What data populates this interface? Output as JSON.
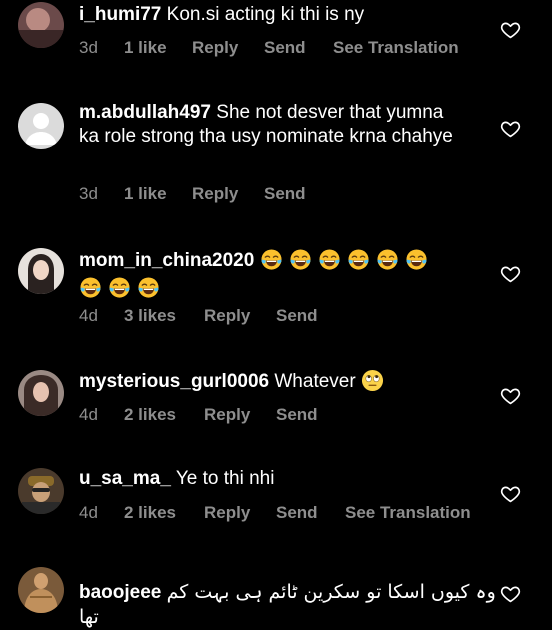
{
  "comments": [
    {
      "username": "i_humi77",
      "text": "Kon.si acting ki thi is ny",
      "time": "3d",
      "likes": "1 like",
      "reply": "Reply",
      "send": "Send",
      "translate": "See Translation"
    },
    {
      "username": "m.abdullah497",
      "text": "She not desver that yumna ka role strong tha usy nominate krna chahye",
      "time": "3d",
      "likes": "1 like",
      "reply": "Reply",
      "send": "Send"
    },
    {
      "username": "mom_in_china2020",
      "text": "",
      "emoji": "face-with-tears-of-joy",
      "emoji_count": 9,
      "time": "4d",
      "likes": "3 likes",
      "reply": "Reply",
      "send": "Send"
    },
    {
      "username": "mysterious_gurl0006",
      "text": "Whatever",
      "emoji": "face-with-rolling-eyes",
      "time": "4d",
      "likes": "2 likes",
      "reply": "Reply",
      "send": "Send"
    },
    {
      "username": "u_sa_ma_",
      "text": "Ye to thi nhi",
      "time": "4d",
      "likes": "2 likes",
      "reply": "Reply",
      "send": "Send",
      "translate": "See Translation"
    },
    {
      "username": "baoojeee",
      "text": "وہ کیوں اسکا تو سکرین ٹائم ہی بہت کم تھا"
    }
  ],
  "icons": {
    "like": "heart-outline-icon",
    "avatar_default": "default-avatar-icon"
  },
  "colors": {
    "background": "#000000",
    "text": "#ffffff",
    "meta": "#8e8e8e"
  }
}
